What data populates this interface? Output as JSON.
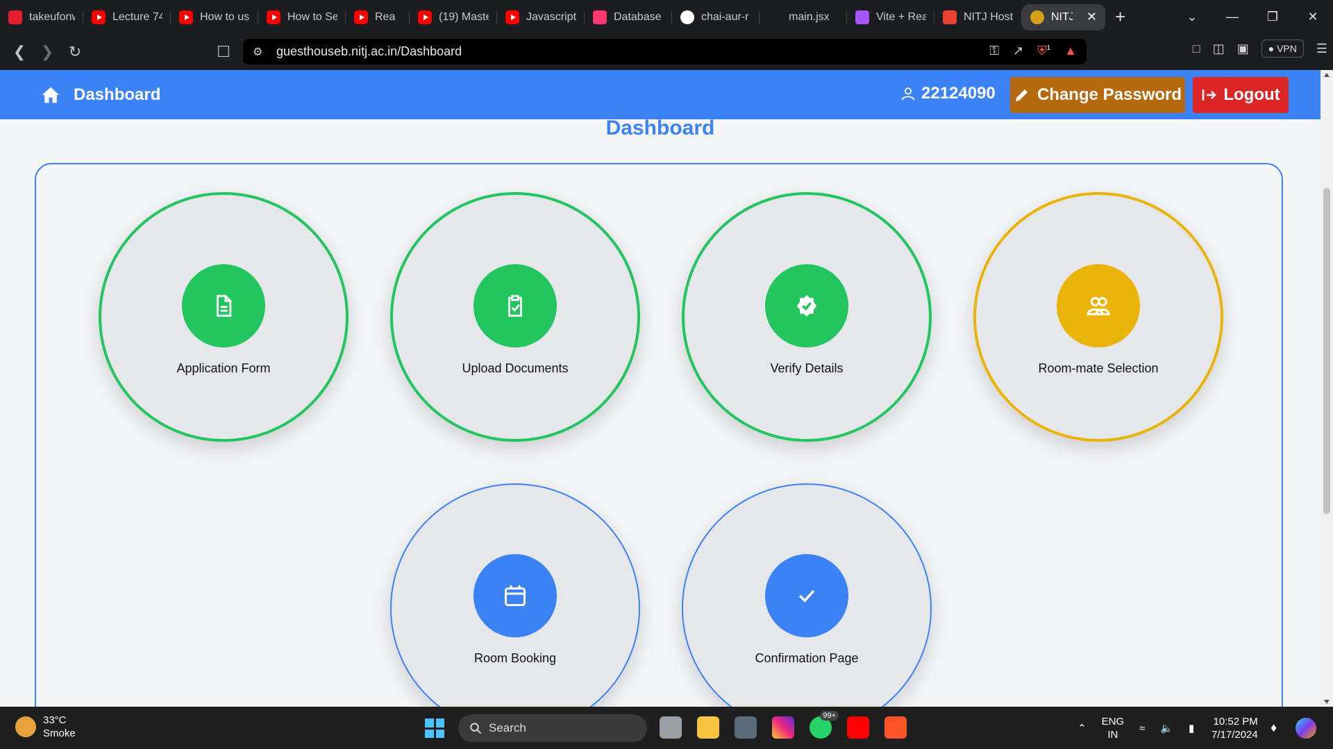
{
  "browser": {
    "tabs": [
      {
        "title": "takeufonw",
        "icon": "tuf-icon",
        "color": "#e11d2e",
        "active": false
      },
      {
        "title": "Lecture 74",
        "icon": "youtube-icon",
        "active": false
      },
      {
        "title": "How to us",
        "icon": "youtube-icon",
        "active": false
      },
      {
        "title": "How to Se",
        "icon": "youtube-icon",
        "active": false
      },
      {
        "title": "Rea",
        "icon": "youtube-icon",
        "active": false
      },
      {
        "title": "(19) Maste",
        "icon": "youtube-icon",
        "active": false
      },
      {
        "title": "Javascript",
        "icon": "youtube-icon",
        "active": false
      },
      {
        "title": "Database",
        "icon": "appwrite-icon",
        "color": "#fd366e",
        "active": false
      },
      {
        "title": "chai-aur-r",
        "icon": "github-icon",
        "color": "#ffffff",
        "active": false
      },
      {
        "title": "main.jsx",
        "icon": "github-icon",
        "color": "#1c1d21",
        "active": false
      },
      {
        "title": "Vite + Rea",
        "icon": "vite-icon",
        "color": "#a855f7",
        "active": false
      },
      {
        "title": "NITJ Hoste",
        "icon": "gmail-icon",
        "color": "#ea4335",
        "active": false
      },
      {
        "title": "NITJ |",
        "icon": "nitj-icon",
        "color": "#d4a017",
        "active": true
      }
    ],
    "new_tab": "+",
    "url": "guesthouseb.nitj.ac.in/Dashboard",
    "vpn_label": "VPN",
    "brave_badge": "1"
  },
  "header": {
    "title": "Dashboard",
    "user_id": "22124090",
    "change_password": "Change Password",
    "logout": "Logout"
  },
  "page": {
    "heading": "Dashboard"
  },
  "steps": [
    {
      "label": "Application Form",
      "icon": "document-icon",
      "status": "complete",
      "color": "#22c55e"
    },
    {
      "label": "Upload Documents",
      "icon": "clipboard-check-icon",
      "status": "complete",
      "color": "#22c55e"
    },
    {
      "label": "Verify Details",
      "icon": "badge-check-icon",
      "status": "complete",
      "color": "#22c55e"
    },
    {
      "label": "Room-mate Selection",
      "icon": "users-icon",
      "status": "in-progress",
      "color": "#eab308"
    },
    {
      "label": "Room Booking",
      "icon": "calendar-icon",
      "status": "pending",
      "color": "#3b82f6"
    },
    {
      "label": "Confirmation Page",
      "icon": "check-icon",
      "status": "pending",
      "color": "#3b82f6"
    }
  ],
  "taskbar": {
    "temperature": "33°C",
    "weather": "Smoke",
    "search": "Search",
    "whatsapp_badge": "99+",
    "lang_primary": "ENG",
    "lang_secondary": "IN",
    "time": "10:52 PM",
    "date": "7/17/2024"
  }
}
